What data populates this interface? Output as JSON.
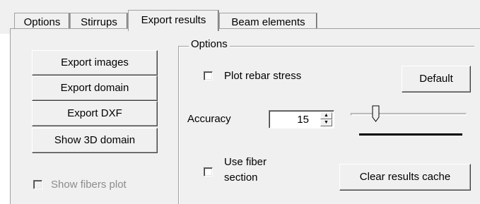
{
  "tabs": [
    {
      "label": "Options"
    },
    {
      "label": "Stirrups"
    },
    {
      "label": "Export results"
    },
    {
      "label": "Beam elements"
    }
  ],
  "buttons": {
    "export_images": "Export images",
    "export_domain": "Export domain",
    "export_dxf": "Export DXF",
    "show_3d_domain": "Show 3D domain",
    "default": "Default",
    "clear_results_cache": "Clear results cache"
  },
  "show_fibers_plot": {
    "label": "Show fibers plot",
    "checked": false,
    "enabled": false
  },
  "options_group": {
    "title": "Options",
    "plot_rebar_stress": {
      "label": "Plot rebar stress",
      "checked": false
    },
    "accuracy": {
      "label": "Accuracy",
      "value": "15",
      "slider_fraction": 0.2
    },
    "use_fiber_section": {
      "label_line1": "Use fiber",
      "label_line2": "section",
      "checked": false
    }
  },
  "icons": {
    "spin_up": "up-arrow-icon",
    "spin_down": "down-arrow-icon"
  }
}
